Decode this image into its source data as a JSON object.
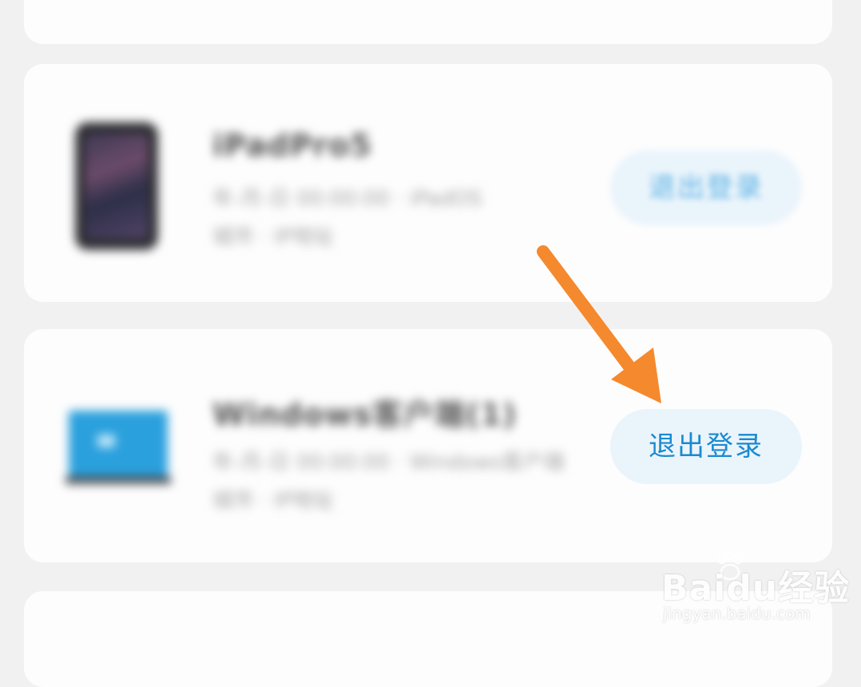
{
  "devices": [
    {
      "name": "iPadPro5",
      "line1": "年-月-日 00:00:00 · iPadOS",
      "line2": "城市 · IP地址",
      "icon": "ipad-icon",
      "logout_label": "退出登录"
    },
    {
      "name": "Windows客户端(1)",
      "line1": "年-月-日 00:00:00 · Windows客户端",
      "line2": "城市 · IP地址",
      "icon": "laptop-icon",
      "logout_label": "退出登录"
    }
  ],
  "annotation": {
    "arrow_color": "#f5892e"
  },
  "watermark": {
    "brand": "Baidu经验",
    "url": "jingyan.baidu.com"
  },
  "colors": {
    "accent": "#1a8ad0",
    "button_bg": "#eaf4fb",
    "page_bg": "#f1f1f1",
    "card_bg": "#fdfdfd"
  }
}
